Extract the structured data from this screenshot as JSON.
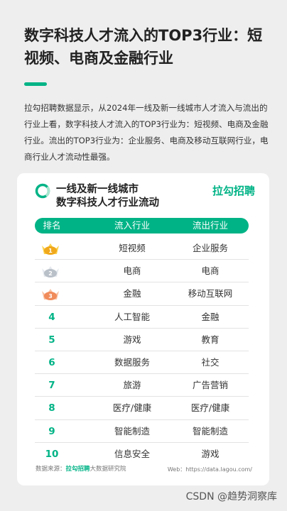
{
  "headline": "数字科技人才流入的TOP3行业：短视频、电商及金融行业",
  "intro": "拉勾招聘数据显示，从2024年一线及新一线城市人才流入与流出的行业上看，数字科技人才流入的TOP3行业为：短视频、电商及金融行业。流出的TOP3行业为：企业服务、电商及移动互联网行业，电商行业人才流动性最强。",
  "card": {
    "title_line1": "一线及新一线城市",
    "title_line2": "数字科技人才行业流动",
    "brand": "拉勾招聘",
    "columns": {
      "rank": "排名",
      "inflow": "流入行业",
      "outflow": "流出行业"
    },
    "rows": [
      {
        "rank": "1",
        "medal": "gold-medal-icon",
        "inflow": "短视频",
        "outflow": "企业服务"
      },
      {
        "rank": "2",
        "medal": "silver-medal-icon",
        "inflow": "电商",
        "outflow": "电商"
      },
      {
        "rank": "3",
        "medal": "bronze-medal-icon",
        "inflow": "金融",
        "outflow": "移动互联网"
      },
      {
        "rank": "4",
        "inflow": "人工智能",
        "outflow": "金融"
      },
      {
        "rank": "5",
        "inflow": "游戏",
        "outflow": "教育"
      },
      {
        "rank": "6",
        "inflow": "数据服务",
        "outflow": "社交"
      },
      {
        "rank": "7",
        "inflow": "旅游",
        "outflow": "广告营销"
      },
      {
        "rank": "8",
        "inflow": "医疗/健康",
        "outflow": "医疗/健康"
      },
      {
        "rank": "9",
        "inflow": "智能制造",
        "outflow": "智能制造"
      },
      {
        "rank": "10",
        "inflow": "信息安全",
        "outflow": "游戏"
      }
    ],
    "source_prefix": "数据来源：",
    "source_brand": "拉勾招聘",
    "source_suffix": "大数据研究院",
    "web": "Web：https://data.lagou.com/"
  },
  "watermark": "CSDN @趋势洞察库",
  "colors": {
    "accent": "#00b386",
    "gold": "#f0a81c",
    "silver": "#b9c0c8",
    "bronze": "#f08b5a"
  }
}
